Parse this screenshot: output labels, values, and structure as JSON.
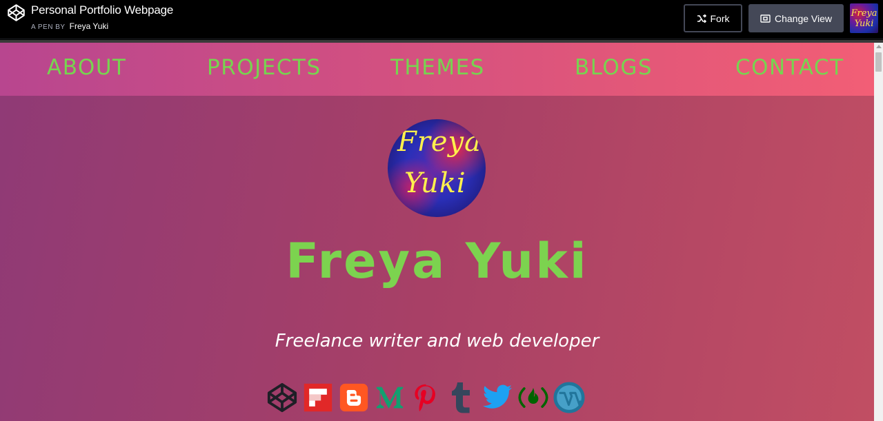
{
  "codepen": {
    "pen_title": "Personal Portfolio Webpage",
    "by_prefix": "A PEN BY",
    "author": "Freya Yuki",
    "fork_label": "Fork",
    "change_view_label": "Change View",
    "avatar_text": [
      "Freya",
      "Yuki"
    ]
  },
  "nav": {
    "items": [
      {
        "label": "ABOUT"
      },
      {
        "label": "PROJECTS"
      },
      {
        "label": "THEMES"
      },
      {
        "label": "BLOGS"
      },
      {
        "label": "CONTACT"
      }
    ]
  },
  "hero": {
    "profile_text": [
      "Freya",
      "Yuki"
    ],
    "name": "Freya Yuki",
    "tagline": "Freelance writer and web developer"
  },
  "socials": [
    {
      "icon": "codepen-icon",
      "color": "#1e1f26"
    },
    {
      "icon": "flipboard-icon",
      "color": "#e12828"
    },
    {
      "icon": "blogger-icon",
      "color": "#ff5722"
    },
    {
      "icon": "medium-icon",
      "color": "#12a070"
    },
    {
      "icon": "pinterest-icon",
      "color": "#e60023"
    },
    {
      "icon": "tumblr-icon",
      "color": "#35465c"
    },
    {
      "icon": "twitter-icon",
      "color": "#1da1f2"
    },
    {
      "icon": "freecodecamp-icon",
      "color": "#006400"
    },
    {
      "icon": "wordpress-icon",
      "color": "#21759b"
    }
  ],
  "colors": {
    "accent_green": "#7cd34f",
    "nav_gradient_start": "#b8468f",
    "nav_gradient_end": "#f25e76",
    "page_gradient_start": "#8f3a76",
    "page_gradient_end": "#c14e63",
    "codepen_bar": "#000000"
  }
}
